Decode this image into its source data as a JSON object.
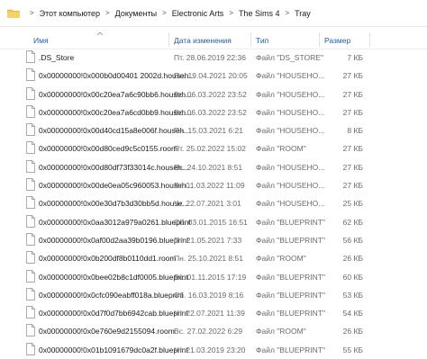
{
  "breadcrumb": {
    "items": [
      "Этот компьютер",
      "Документы",
      "Electronic Arts",
      "The Sims 4",
      "Tray"
    ],
    "separator": ">"
  },
  "columns": {
    "name": "Имя",
    "date": "Дата изменения",
    "type": "Тип",
    "size": "Размер"
  },
  "files": [
    {
      "name": ".DS_Store",
      "date": "Пт. 28.06.2019 22:36",
      "type": "Файл \"DS_STORE\"",
      "size": "7 КБ"
    },
    {
      "name": "0x00000000!0x000b0d00401 2002d.househ...",
      "date": "Пн. 19.04.2021 20:05",
      "type": "Файл \"HOUSEHO...",
      "size": "27 КБ"
    },
    {
      "name": "0x00000000!0x00c20ea7a6c90bb6.househ...",
      "date": "Вс. 06.03.2022 23:52",
      "type": "Файл \"HOUSEHO...",
      "size": "27 КБ"
    },
    {
      "name": "0x00000000!0x00c20ea7a6cd0bb9.househ...",
      "date": "Вс. 06.03.2022 23:52",
      "type": "Файл \"HOUSEHO...",
      "size": "27 КБ"
    },
    {
      "name": "0x00000000!0x00d40cd15a8e006f.househ...",
      "date": "Пн. 15.03.2021 6:21",
      "type": "Файл \"HOUSEHO...",
      "size": "8 КБ"
    },
    {
      "name": "0x00000000!0x00d80ced9c5c0155.room",
      "date": "Пт. 25.02.2022 15:02",
      "type": "Файл \"ROOM\"",
      "size": "27 КБ"
    },
    {
      "name": "0x00000000!0x00d80df73f33014c.househ...",
      "date": "Вс. 24.10.2021 8:51",
      "type": "Файл \"HOUSEHO...",
      "size": "27 КБ"
    },
    {
      "name": "0x00000000!0x00de0ea05c960053.househ...",
      "date": "Вт. 01.03.2022 11:09",
      "type": "Файл \"HOUSEHO...",
      "size": "27 КБ"
    },
    {
      "name": "0x00000000!0x00e30d7b3d30bb5d.house...",
      "date": "Чт. 22.07.2021 3:01",
      "type": "Файл \"HOUSEHO...",
      "size": "25 КБ"
    },
    {
      "name": "0x00000000!0x0aa3012a979a0261.blueprint",
      "date": "Сб. 03.01.2015 16:51",
      "type": "Файл \"BLUEPRINT\"",
      "size": "62 КБ"
    },
    {
      "name": "0x00000000!0x0af00d2aa39b0196.blueprint",
      "date": "Пт. 21.05.2021 7:33",
      "type": "Файл \"BLUEPRINT\"",
      "size": "56 КБ"
    },
    {
      "name": "0x00000000!0x0b200df8b0110dd1.room",
      "date": "Пн. 25.10.2021 8:51",
      "type": "Файл \"ROOM\"",
      "size": "26 КБ"
    },
    {
      "name": "0x00000000!0x0bee02b8c1df0005.blueprint",
      "date": "Вс. 01.11.2015 17:19",
      "type": "Файл \"BLUEPRINT\"",
      "size": "60 КБ"
    },
    {
      "name": "0x00000000!0x0cfc090eabff018a.blueprint",
      "date": "Сб. 16.03.2019 8:16",
      "type": "Файл \"BLUEPRINT\"",
      "size": "53 КБ"
    },
    {
      "name": "0x00000000!0x0d7f0d7bb6942cab.blueprint",
      "date": "Чт. 22.07.2021 11:39",
      "type": "Файл \"BLUEPRINT\"",
      "size": "54 КБ"
    },
    {
      "name": "0x00000000!0x0e760e9d2155094.room",
      "date": "Вс. 27.02.2022 6:29",
      "type": "Файл \"ROOM\"",
      "size": "26 КБ"
    },
    {
      "name": "0x00000000!0x01b1091679dc0a2f.blueprint",
      "date": "Чт. 21.03.2019 23:20",
      "type": "Файл \"BLUEPRINT\"",
      "size": "55 КБ"
    }
  ],
  "colors": {
    "folder": "#f4c542",
    "header_text": "#2a5a99",
    "secondary_text": "#6b6b6b"
  },
  "icons": {
    "breadcrumb": "folder-icon",
    "file": "file-icon",
    "sort": "chevron-up-icon"
  }
}
